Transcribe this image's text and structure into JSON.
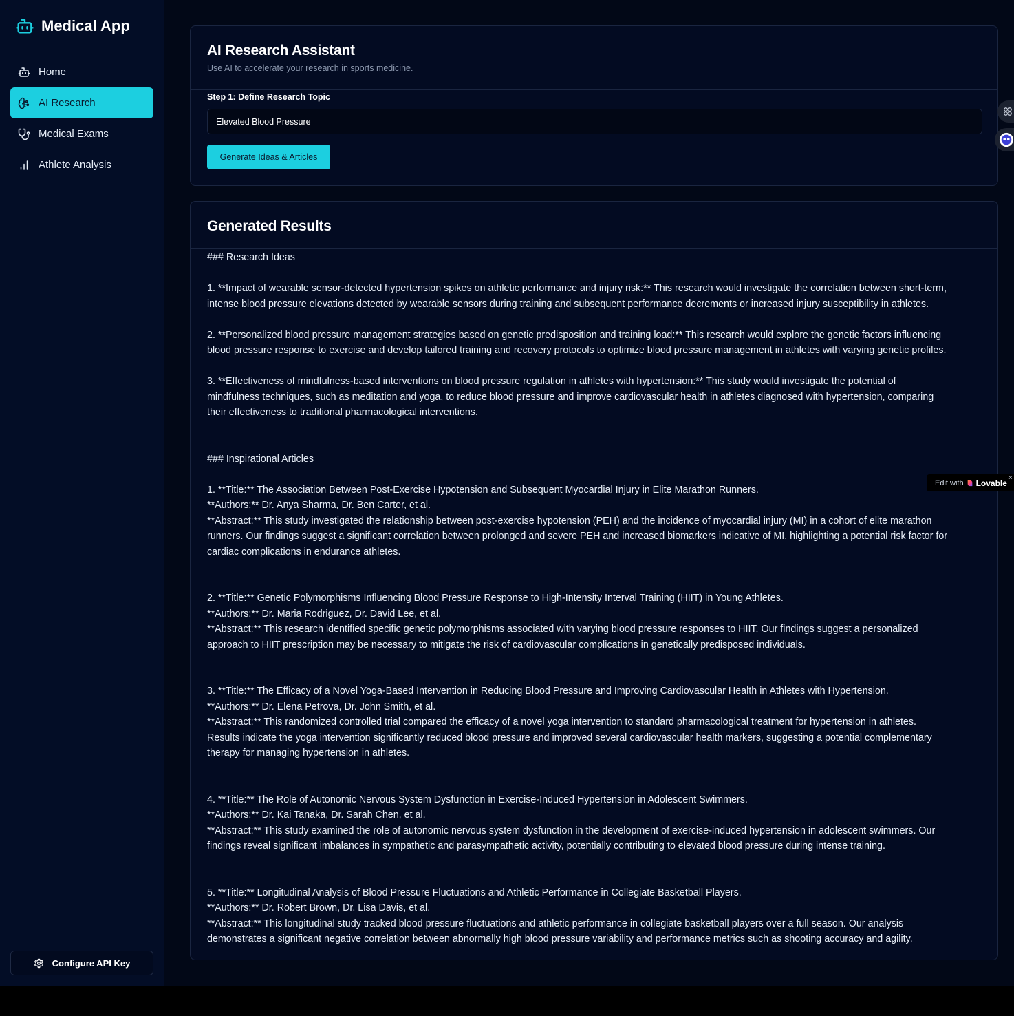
{
  "sidebar": {
    "brand": "Medical App",
    "items": [
      {
        "label": "Home",
        "icon": "bot-icon"
      },
      {
        "label": "AI Research",
        "icon": "brain-icon",
        "active": true
      },
      {
        "label": "Medical Exams",
        "icon": "stethoscope-icon"
      },
      {
        "label": "Athlete Analysis",
        "icon": "bar-chart-icon"
      }
    ],
    "config_label": "Configure API Key"
  },
  "research": {
    "title": "AI Research Assistant",
    "subtitle": "Use AI to accelerate your research in sports medicine.",
    "step_label": "Step 1: Define Research Topic",
    "topic_value": "Elevated Blood Pressure",
    "generate_label": "Generate Ideas & Articles"
  },
  "results": {
    "title": "Generated Results",
    "lines": [
      "### Research Ideas",
      "",
      "1. **Impact of wearable sensor-detected hypertension spikes on athletic performance and injury risk:** This research would investigate the correlation between short-term,",
      "intense blood pressure elevations detected by wearable sensors during training and subsequent performance decrements or increased injury susceptibility in athletes.",
      "",
      "2. **Personalized blood pressure management strategies based on genetic predisposition and training load:** This research would explore the genetic factors influencing",
      "blood pressure response to exercise and develop tailored training and recovery protocols to optimize blood pressure management in athletes with varying genetic profiles.",
      "",
      "3. **Effectiveness of mindfulness-based interventions on blood pressure regulation in athletes with hypertension:** This study would investigate the potential of",
      "mindfulness techniques, such as meditation and yoga, to reduce blood pressure and improve cardiovascular health in athletes diagnosed with hypertension, comparing",
      "their effectiveness to traditional pharmacological interventions.",
      "",
      "",
      "### Inspirational Articles",
      "",
      "1. **Title:** The Association Between Post-Exercise Hypotension and Subsequent Myocardial Injury in Elite Marathon Runners.",
      "**Authors:** Dr. Anya Sharma, Dr. Ben Carter, et al.",
      "**Abstract:** This study investigated the relationship between post-exercise hypotension (PEH) and the incidence of myocardial injury (MI) in a cohort of elite marathon",
      "runners. Our findings suggest a significant correlation between prolonged and severe PEH and increased biomarkers indicative of MI, highlighting a potential risk factor for",
      "cardiac complications in endurance athletes.",
      "",
      "",
      "2. **Title:** Genetic Polymorphisms Influencing Blood Pressure Response to High-Intensity Interval Training (HIIT) in Young Athletes.",
      "**Authors:** Dr. Maria Rodriguez, Dr. David Lee, et al.",
      "**Abstract:** This research identified specific genetic polymorphisms associated with varying blood pressure responses to HIIT. Our findings suggest a personalized",
      "approach to HIIT prescription may be necessary to mitigate the risk of cardiovascular complications in genetically predisposed individuals.",
      "",
      "",
      "3. **Title:** The Efficacy of a Novel Yoga-Based Intervention in Reducing Blood Pressure and Improving Cardiovascular Health in Athletes with Hypertension.",
      "**Authors:** Dr. Elena Petrova, Dr. John Smith, et al.",
      "**Abstract:** This randomized controlled trial compared the efficacy of a novel yoga intervention to standard pharmacological treatment for hypertension in athletes.",
      "Results indicate the yoga intervention significantly reduced blood pressure and improved several cardiovascular health markers, suggesting a potential complementary",
      "therapy for managing hypertension in athletes.",
      "",
      "",
      "4. **Title:** The Role of Autonomic Nervous System Dysfunction in Exercise-Induced Hypertension in Adolescent Swimmers.",
      "**Authors:** Dr. Kai Tanaka, Dr. Sarah Chen, et al.",
      "**Abstract:** This study examined the role of autonomic nervous system dysfunction in the development of exercise-induced hypertension in adolescent swimmers. Our",
      "findings reveal significant imbalances in sympathetic and parasympathetic activity, potentially contributing to elevated blood pressure during intense training.",
      "",
      "",
      "5. **Title:** Longitudinal Analysis of Blood Pressure Fluctuations and Athletic Performance in Collegiate Basketball Players.",
      "**Authors:** Dr. Robert Brown, Dr. Lisa Davis, et al.",
      "**Abstract:** This longitudinal study tracked blood pressure fluctuations and athletic performance in collegiate basketball players over a full season. Our analysis",
      "demonstrates a significant negative correlation between abnormally high blood pressure variability and performance metrics such as shooting accuracy and agility."
    ]
  },
  "lovable_badge": {
    "prefix": "Edit with",
    "brand": "Lovable",
    "close": "×"
  },
  "colors": {
    "accent": "#1ccfe0",
    "background": "#020817",
    "card": "#030b22"
  }
}
